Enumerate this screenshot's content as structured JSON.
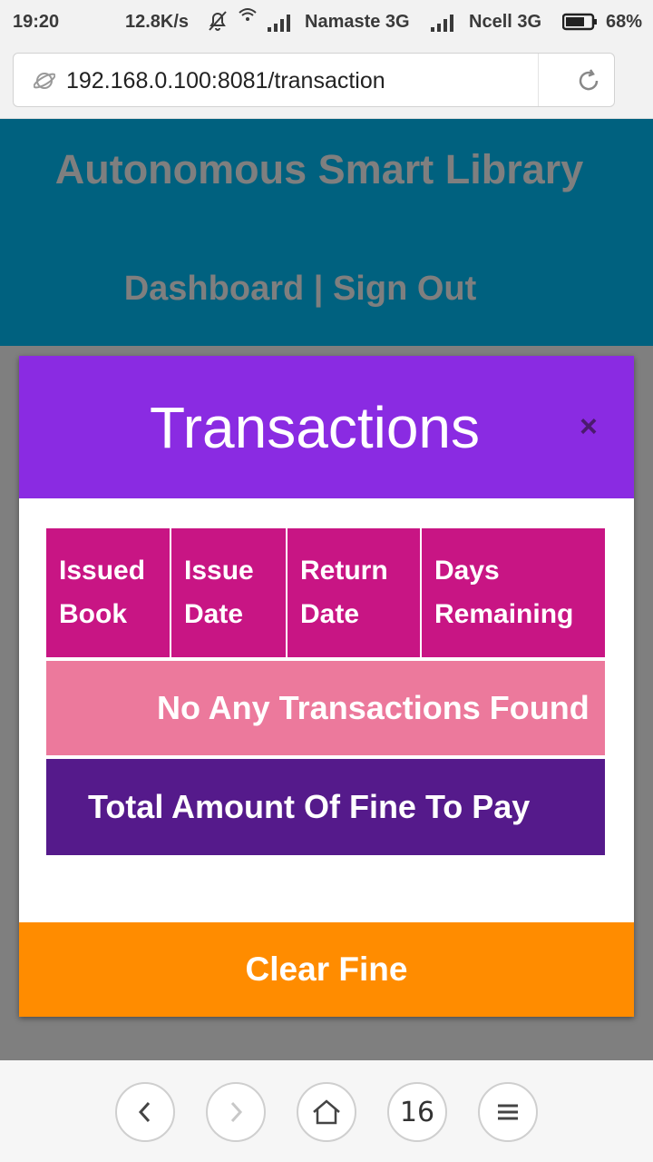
{
  "status_bar": {
    "time": "19:20",
    "speed": "12.8K/s",
    "carrier1": "Namaste 3G",
    "carrier2": "Ncell 3G",
    "battery": "68%",
    "icons": [
      "bell-off-icon",
      "wifi-icon",
      "signal-icon",
      "signal-icon",
      "battery-icon"
    ]
  },
  "browser": {
    "url": "192.168.0.100:8081/transaction",
    "icons": [
      "globe-icon",
      "reload-icon"
    ]
  },
  "site": {
    "title": "Autonomous Smart Library",
    "nav_dashboard": "Dashboard",
    "nav_separator": " | ",
    "nav_signout": "Sign Out",
    "header_color": "#00617f"
  },
  "modal": {
    "title": "Transactions",
    "close": "×",
    "header_color": "#8a2be2",
    "table": {
      "columns": [
        {
          "line1": "Issued",
          "line2": "Book"
        },
        {
          "line1": "Issue",
          "line2": "Date"
        },
        {
          "line1": "Return",
          "line2": "Date"
        },
        {
          "line1": "Days",
          "line2": "Remaining"
        }
      ],
      "empty_message": "No Any Transactions Found",
      "total_fine_label": "Total Amount Of Fine To Pay"
    },
    "clear_button": "Clear Fine",
    "colors": {
      "header_cells": "#c81584",
      "empty_row": "#ec799c",
      "fine_row": "#551a8b",
      "button": "#ff8c00"
    }
  },
  "bottom_nav": {
    "tab_count": "16",
    "icons": [
      "back-icon",
      "forward-icon",
      "home-icon",
      "tabs-icon",
      "menu-icon"
    ]
  }
}
